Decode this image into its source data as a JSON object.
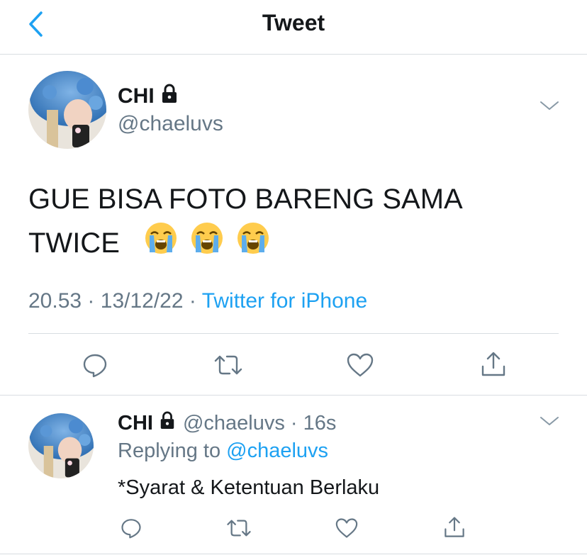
{
  "nav": {
    "title": "Tweet",
    "back_icon": "chevron-left-icon"
  },
  "colors": {
    "accent": "#1da1f2",
    "text": "#14171a",
    "secondary": "#657786",
    "divider": "#d8dde1"
  },
  "tweet": {
    "name": "CHI",
    "handle": "@chaeluvs",
    "text_line1": "GUE BISA FOTO BARENG SAMA",
    "text_line2": "TWICE",
    "emojis": [
      "loudly-crying-face",
      "loudly-crying-face",
      "loudly-crying-face"
    ],
    "time": "20.53",
    "date": "13/12/22",
    "separator": "·",
    "source": "Twitter for iPhone"
  },
  "reply": {
    "name": "CHI",
    "handle_time": "@chaeluvs · 16s",
    "replying_prefix": "Replying to",
    "replying_to": "@chaeluvs",
    "text": "*Syarat & Ketentuan Berlaku"
  }
}
